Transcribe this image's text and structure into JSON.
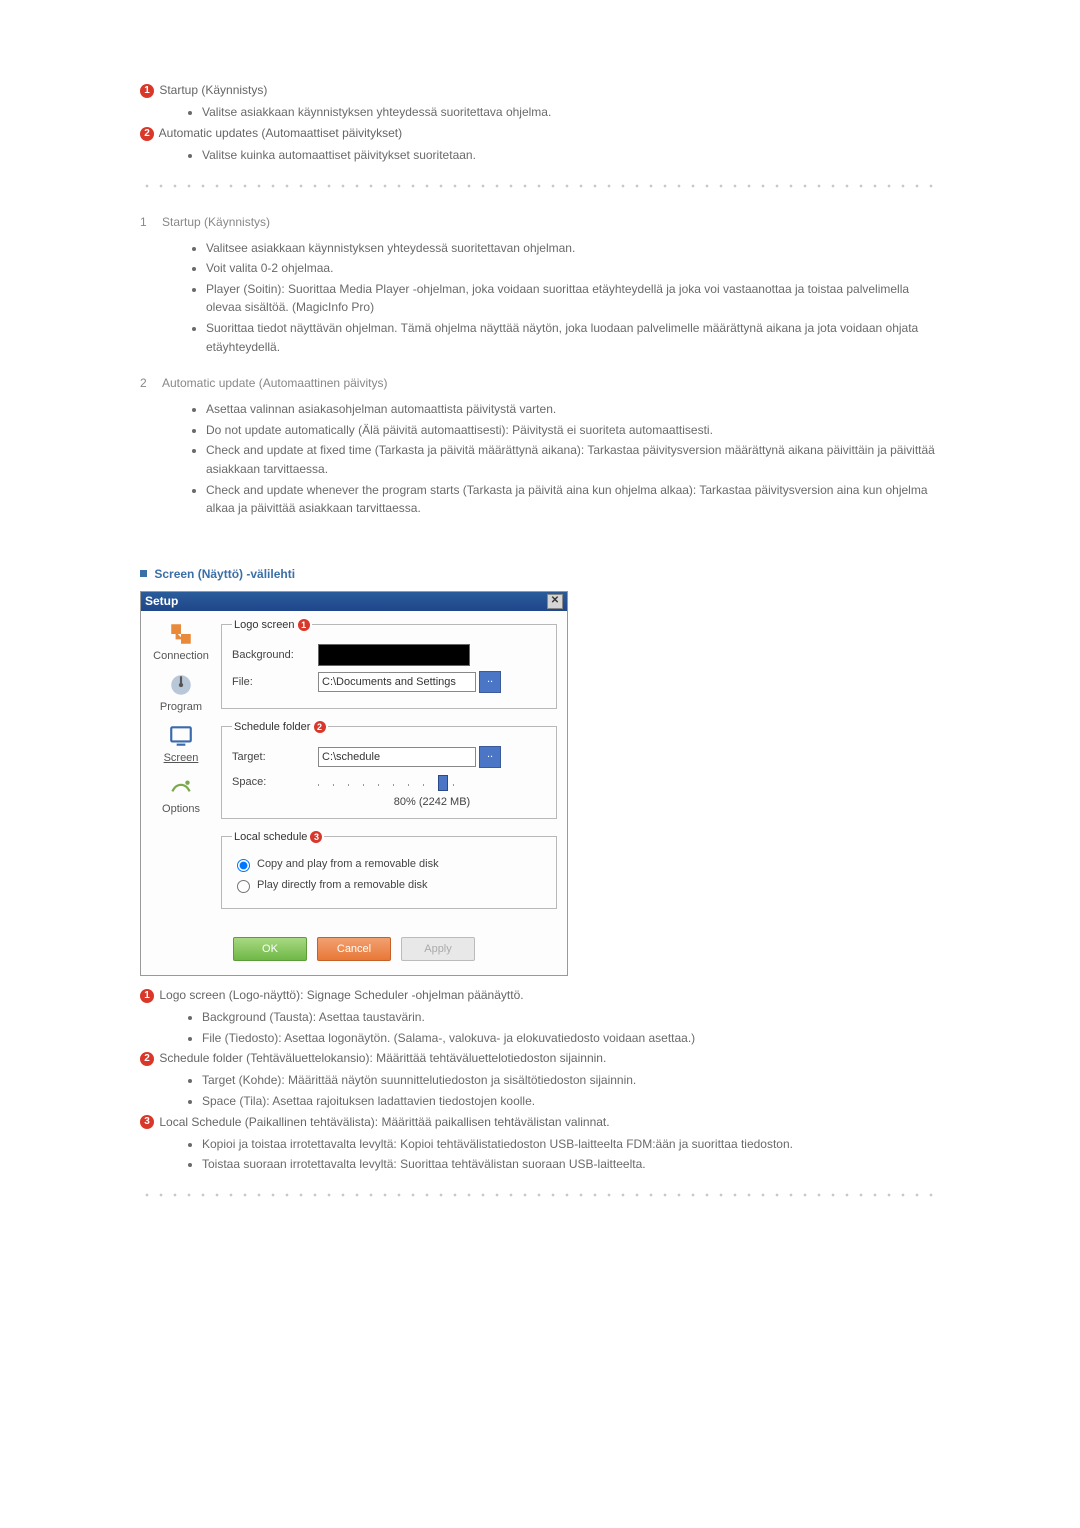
{
  "intro": {
    "items": [
      {
        "badge": "1",
        "title": "Startup (Käynnistys)",
        "bullets": [
          "Valitse asiakkaan käynnistyksen yhteydessä suoritettava ohjelma."
        ]
      },
      {
        "badge": "2",
        "title": "Automatic updates (Automaattiset päivitykset)",
        "bullets": [
          "Valitse kuinka automaattiset päivitykset suoritetaan."
        ]
      }
    ]
  },
  "numbered": [
    {
      "num": "1",
      "title": "Startup (Käynnistys)",
      "bullets": [
        "Valitsee asiakkaan käynnistyksen yhteydessä suoritettavan ohjelman.",
        "Voit valita 0-2 ohjelmaa.",
        "Player (Soitin): Suorittaa Media Player -ohjelman, joka voidaan suorittaa etäyhteydellä ja joka voi vastaanottaa ja toistaa palvelimella olevaa sisältöä. (MagicInfo Pro)",
        "Suorittaa tiedot näyttävän ohjelman. Tämä ohjelma näyttää näytön, joka luodaan palvelimelle määrättynä aikana ja jota voidaan ohjata etäyhteydellä."
      ]
    },
    {
      "num": "2",
      "title": "Automatic update (Automaattinen päivitys)",
      "bullets": [
        "Asettaa valinnan asiakasohjelman automaattista päivitystä varten.",
        "Do not update automatically (Älä päivitä automaattisesti): Päivitystä ei suoriteta automaattisesti.",
        "Check and update at fixed time (Tarkasta ja päivitä määrättynä aikana): Tarkastaa päivitysversion määrättynä aikana päivittäin ja päivittää asiakkaan tarvittaessa.",
        "Check and update whenever the program starts (Tarkasta ja päivitä aina kun ohjelma alkaa): Tarkastaa päivitysversion aina kun ohjelma alkaa ja päivittää asiakkaan tarvittaessa."
      ]
    }
  ],
  "tab_header": "Screen (Näyttö) -välilehti",
  "dialog": {
    "title": "Setup",
    "tabs": {
      "connection": "Connection",
      "program": "Program",
      "screen": "Screen",
      "options": "Options"
    },
    "logo_screen": {
      "legend": "Logo screen",
      "badge": "1",
      "background_label": "Background:",
      "file_label": "File:",
      "file_value": "C:\\Documents and Settings"
    },
    "schedule_folder": {
      "legend": "Schedule folder",
      "badge": "2",
      "target_label": "Target:",
      "target_value": "C:\\schedule",
      "space_label": "Space:",
      "space_value": "80% (2242 MB)"
    },
    "local_schedule": {
      "legend": "Local schedule",
      "badge": "3",
      "opt1": "Copy and play from a removable disk",
      "opt2": "Play directly from a removable disk"
    },
    "buttons": {
      "ok": "OK",
      "cancel": "Cancel",
      "apply": "Apply"
    }
  },
  "after": {
    "items": [
      {
        "badge": "1",
        "title": "Logo screen (Logo-näyttö): Signage Scheduler -ohjelman päänäyttö.",
        "bullets": [
          "Background (Tausta): Asettaa taustavärin.",
          "File (Tiedosto): Asettaa logonäytön. (Salama-, valokuva- ja elokuvatiedosto voidaan asettaa.)"
        ]
      },
      {
        "badge": "2",
        "title": "Schedule folder (Tehtäväluettelokansio): Määrittää tehtäväluettelotiedoston sijainnin.",
        "bullets": [
          "Target (Kohde): Määrittää näytön suunnittelutiedoston ja sisältötiedoston sijainnin.",
          "Space (Tila): Asettaa rajoituksen ladattavien tiedostojen koolle."
        ]
      },
      {
        "badge": "3",
        "title": "Local Schedule (Paikallinen tehtävälista): Määrittää paikallisen tehtävälistan valinnat.",
        "bullets": [
          "Kopioi ja toistaa irrotettavalta levyltä: Kopioi tehtävälistatiedoston USB-laitteelta FDM:ään ja suorittaa tiedoston.",
          "Toistaa suoraan irrotettavalta levyltä: Suorittaa tehtävälistan suoraan USB-laitteelta."
        ]
      }
    ]
  }
}
